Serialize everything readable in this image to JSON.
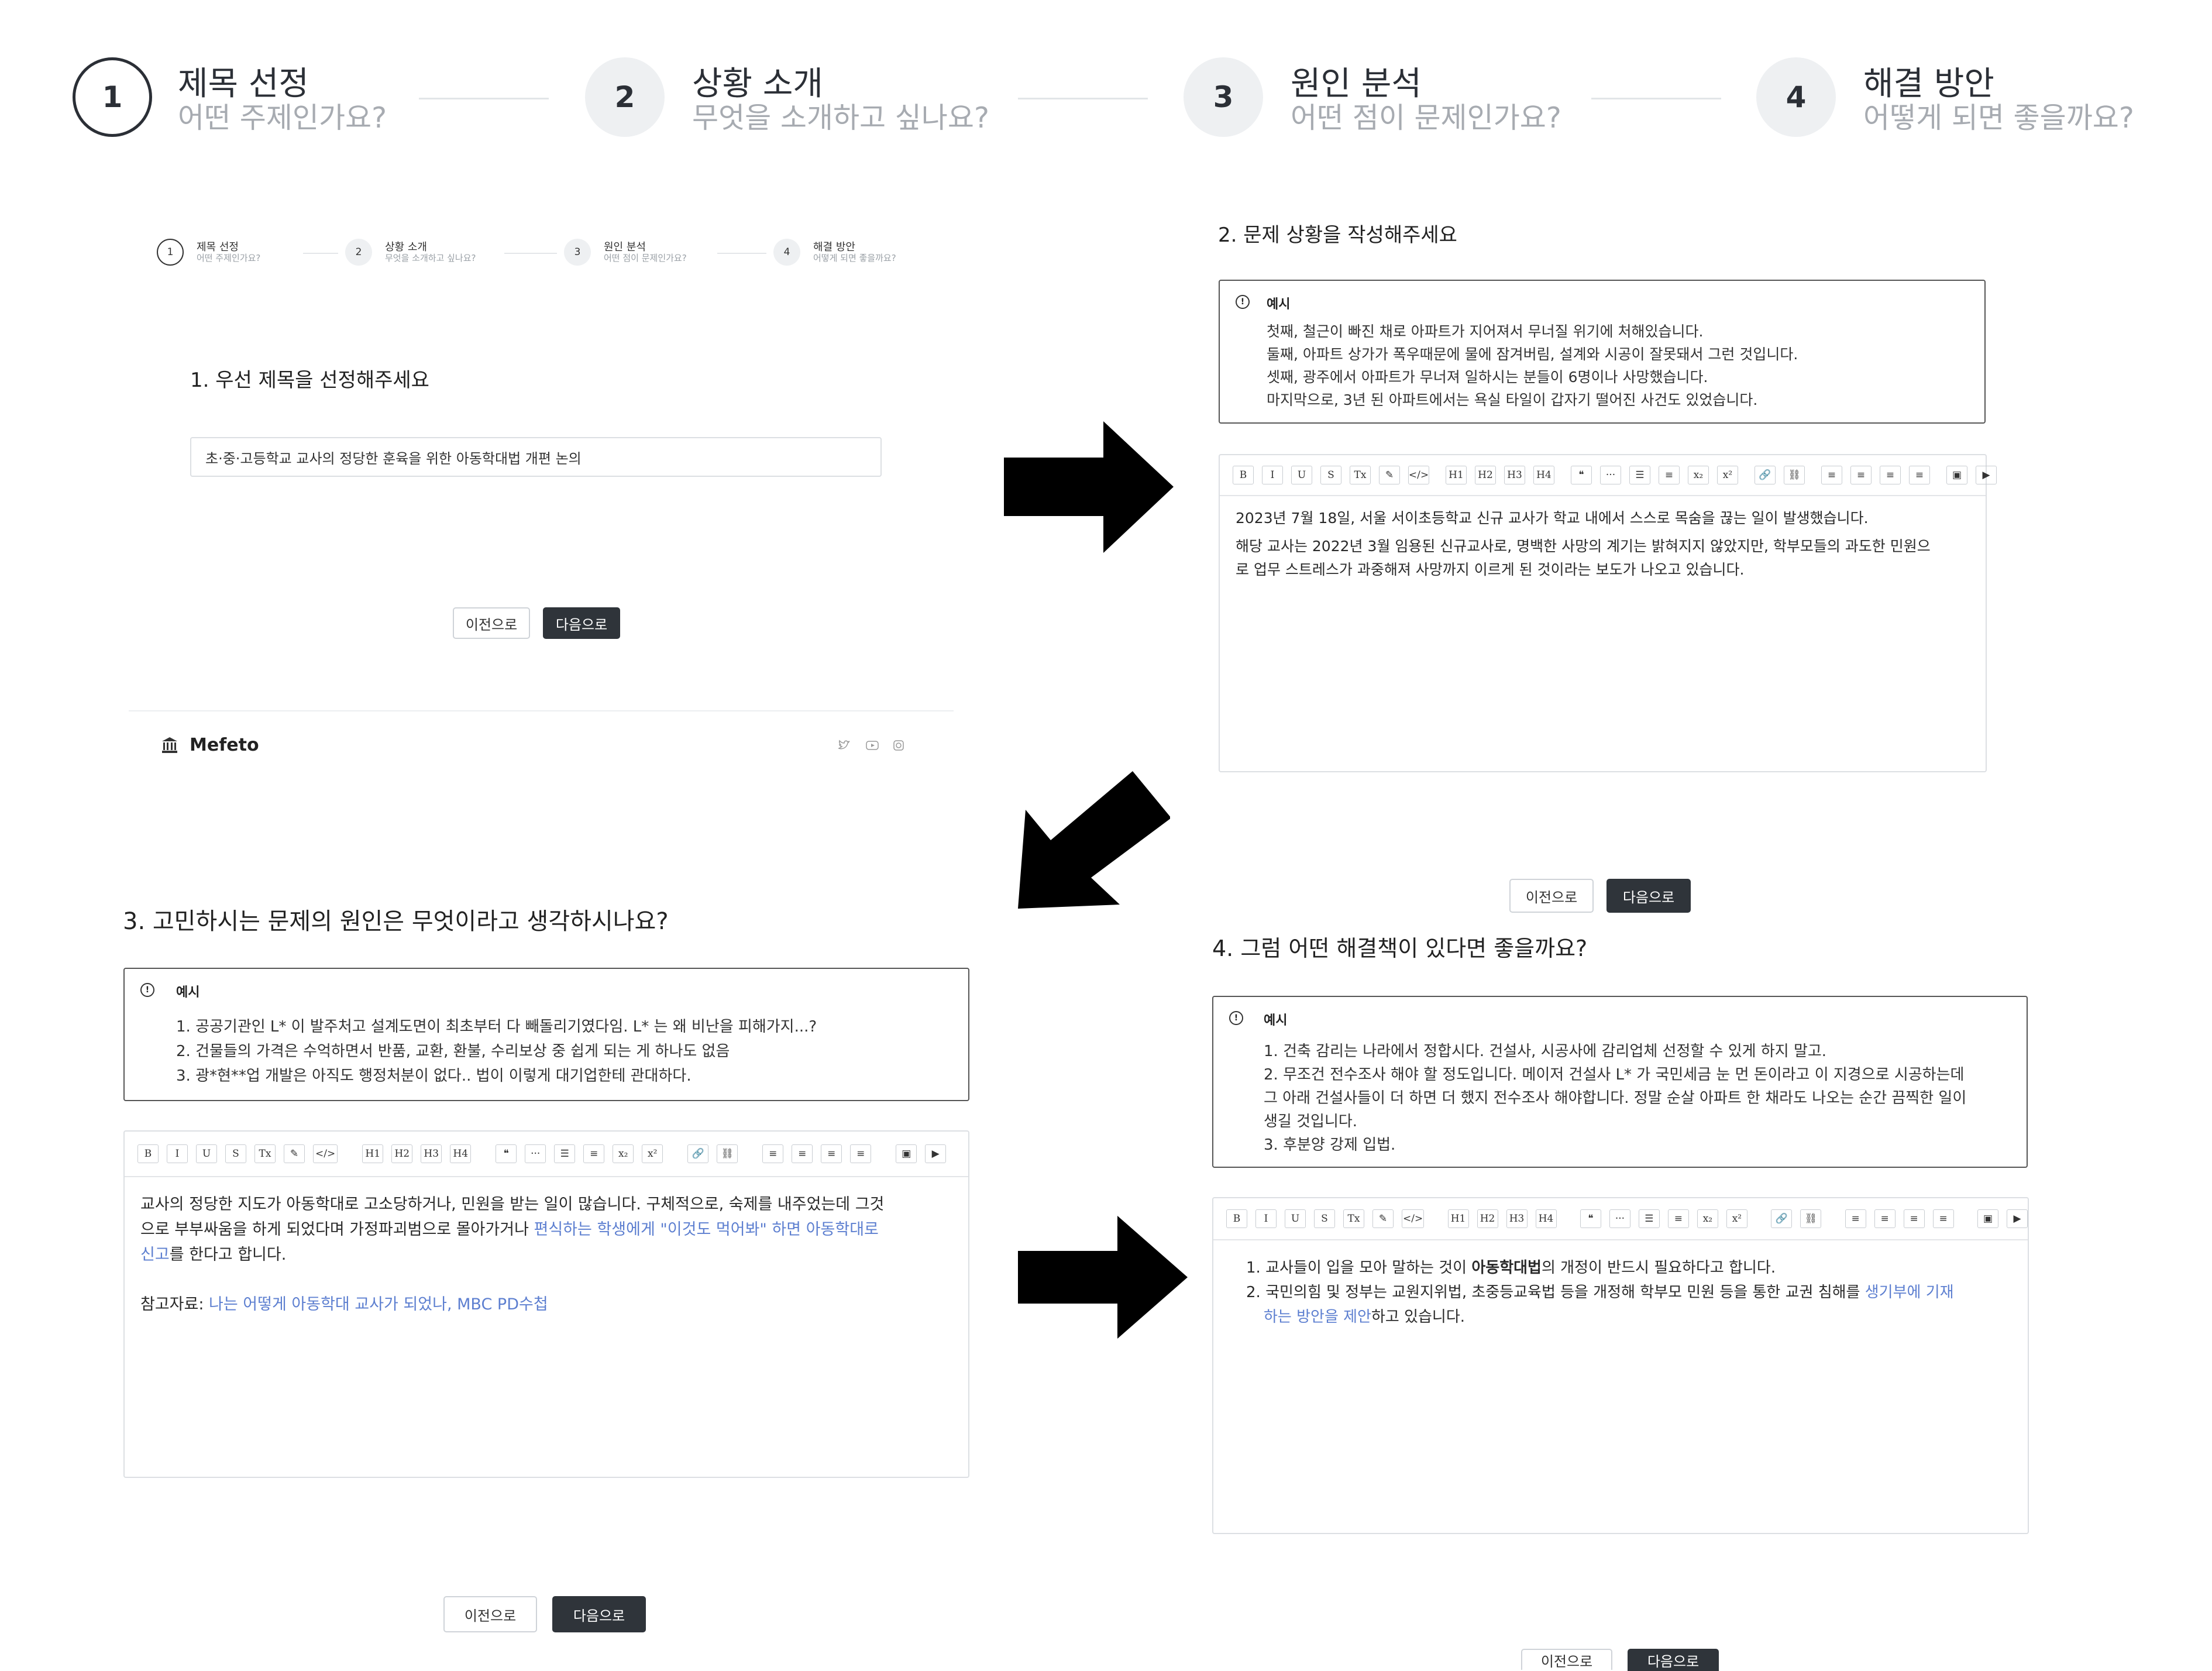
{
  "top_stepper": [
    {
      "num": "1",
      "title": "제목 선정",
      "sub": "어떤 주제인가요?"
    },
    {
      "num": "2",
      "title": "상황 소개",
      "sub": "무엇을 소개하고 싶나요?"
    },
    {
      "num": "3",
      "title": "원인 분석",
      "sub": "어떤 점이 문제인가요?"
    },
    {
      "num": "4",
      "title": "해결 방안",
      "sub": "어떻게 되면 좋을까요?"
    }
  ],
  "step1": {
    "question": "1. 우선 제목을 선정해주세요",
    "title_value": "초·중·고등학교 교사의 정당한 훈육을 위한 아동학대법 개편 논의",
    "prev": "이전으로",
    "next": "다음으로",
    "brand": "Mefeto"
  },
  "step2": {
    "question": "2. 문제 상황을 작성해주세요",
    "example_label": "예시",
    "example_lines": [
      "첫째, 철근이 빠진 채로 아파트가 지어져서 무너질 위기에 처해있습니다.",
      "둘째, 아파트 상가가 폭우때문에 물에 잠겨버림, 설계와 시공이 잘못돼서 그런 것입니다.",
      "셋째, 광주에서 아파트가 무너져 일하시는 분들이 6명이나 사망했습니다.",
      "마지막으로, 3년 된 아파트에서는 욕실 타일이 갑자기 떨어진 사건도 있었습니다."
    ],
    "body_lines": [
      "2023년 7월 18일, 서울 서이초등학교 신규 교사가 학교 내에서 스스로 목숨을 끊는 일이 발생했습니다.",
      "해당 교사는 2022년 3월 임용된 신규교사로, 명백한 사망의 계기는 밝혀지지 않았지만, 학부모들의 과도한 민원으",
      "로 업무 스트레스가 과중해져 사망까지 이르게 된 것이라는 보도가 나오고 있습니다."
    ],
    "prev": "이전으로",
    "next": "다음으로"
  },
  "step3": {
    "question": "3. 고민하시는 문제의 원인은 무엇이라고 생각하시나요?",
    "example_label": "예시",
    "example_lines": [
      "1. 공공기관인 L* 이 발주처고 설계도면이 최초부터 다 빼돌리기였다임. L* 는 왜 비난을 피해가지...?",
      "2. 건물들의 가격은 수억하면서 반품, 교환, 환불, 수리보상 중 쉽게 되는 게 하나도 없음",
      "3. 광*현**업 개발은 아직도 행정처분이 없다.. 법이 이렇게 대기업한테 관대하다."
    ],
    "body_line1": "교사의 정당한 지도가 아동학대로 고소당하거나, 민원을 받는 일이 많습니다. 구체적으로, 숙제를 내주었는데 그것",
    "body_line2a": "으로 부부싸움을 하게 되었다며 가정파괴범으로 몰아가거나 ",
    "body_line2_link": "편식하는 학생에게 \"이것도 먹어봐\" 하면 아동학대로",
    "body_line3_link": "신고",
    "body_line3b": "를 한다고 합니다.",
    "ref_label": "참고자료: ",
    "ref_link": "나는 어떻게 아동학대 교사가 되었나, MBC PD수첩",
    "prev": "이전으로",
    "next": "다음으로"
  },
  "step4": {
    "question": "4. 그럼 어떤 해결책이 있다면 좋을까요?",
    "example_label": "예시",
    "example_lines": [
      "1. 건축 감리는 나라에서 정합시다. 건설사, 시공사에 감리업체 선정할 수 있게 하지 말고.",
      "2. 무조건 전수조사 해야 할 정도입니다. 메이저 건설사 L* 가 국민세금 눈 먼 돈이라고 이 지경으로 시공하는데",
      "그 아래 건설사들이 더 하면 더 했지 전수조사 해야합니다. 정말 순살 아파트 한 채라도 나오는 순간 끔찍한 일이",
      "생길 것입니다.",
      "3. 후분양 강제 입법."
    ],
    "item1a": "1. 교사들이 입을 모아 말하는 것이 ",
    "item1_bold": "아동학대법",
    "item1b": "의 개정이 반드시 필요하다고 합니다.",
    "item2a": "2. 국민의힘 및 정부는 교원지위법, 초중등교육법 등을 개정해 학부모 민원 등을 통한 교권 침해를 ",
    "item2_link": "생기부에 기재",
    "item2_link2": "하는 방안을 제안",
    "item2b": "하고 있습니다.",
    "prev": "이전으로",
    "next": "다음으로"
  },
  "toolbar_labels": [
    "B",
    "I",
    "U",
    "S",
    "Tx",
    "✎",
    "</>",
    "H1",
    "H2",
    "H3",
    "H4",
    "❝",
    "···",
    "☰",
    "≡",
    "x₂",
    "x²",
    "🔗",
    "⛓",
    "≡",
    "≡",
    "≡",
    "≡",
    "▣",
    "▶"
  ]
}
